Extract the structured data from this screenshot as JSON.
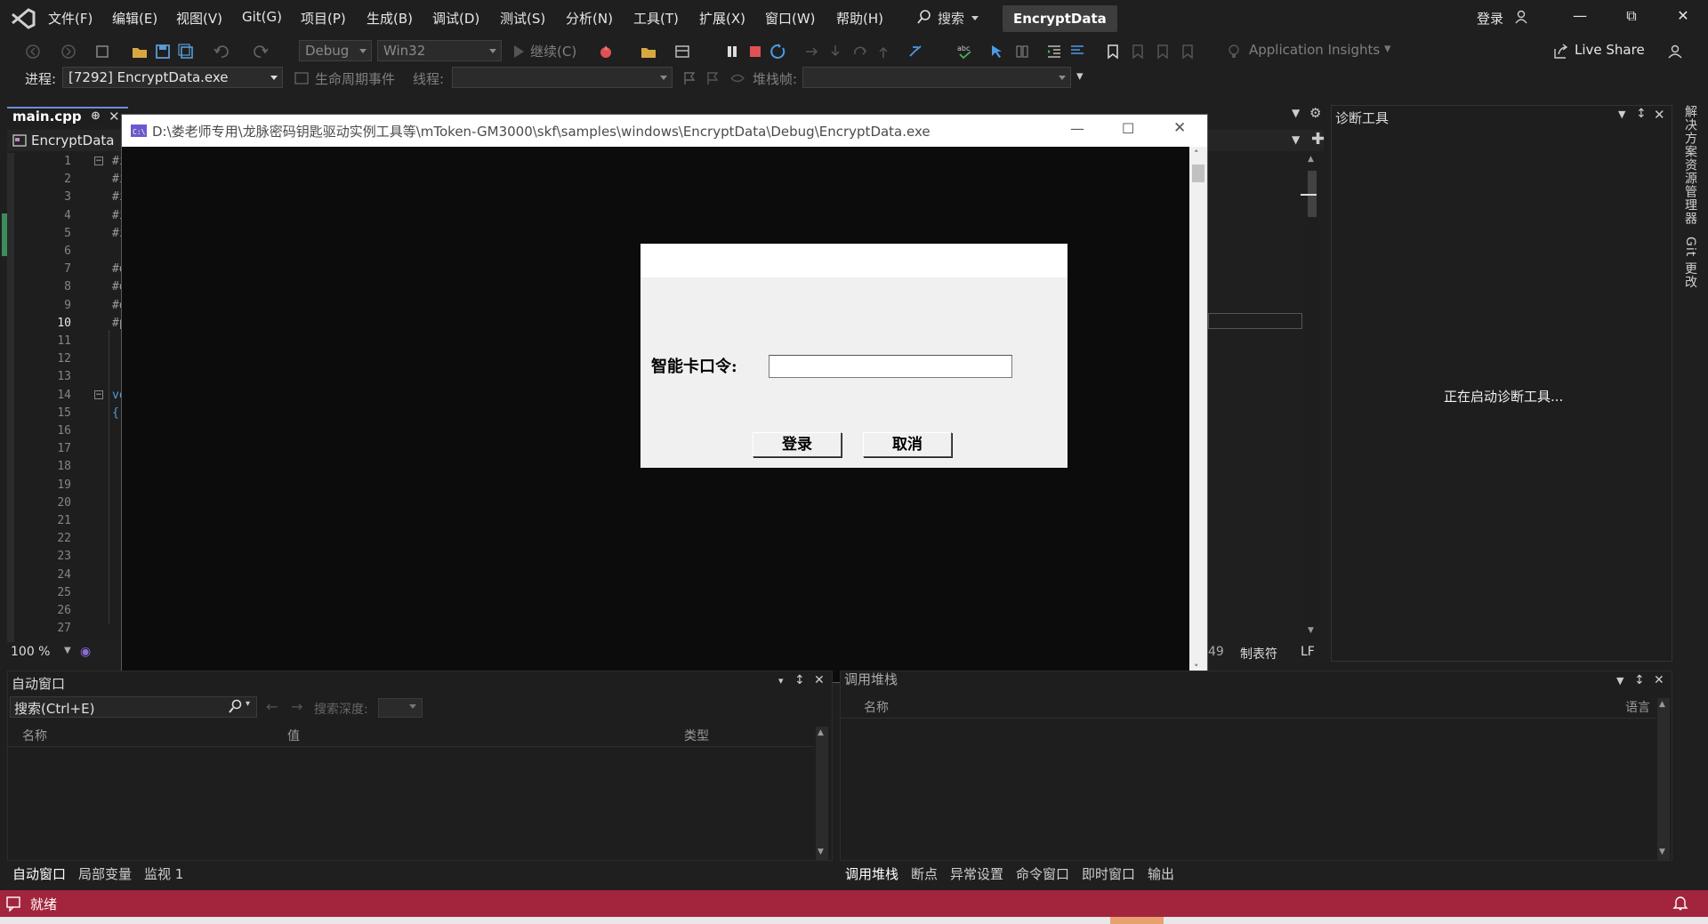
{
  "menu": {
    "items": [
      "文件(F)",
      "编辑(E)",
      "视图(V)",
      "Git(G)",
      "项目(P)",
      "生成(B)",
      "调试(D)",
      "测试(S)",
      "分析(N)",
      "工具(T)",
      "扩展(X)",
      "窗口(W)",
      "帮助(H)"
    ],
    "search_label": "搜索",
    "solution_title": "EncryptData",
    "login_label": "登录"
  },
  "toolbar": {
    "config": "Debug",
    "platform": "Win32",
    "continue_label": "继续(C)",
    "app_insights": "Application Insights",
    "live_share": "Live Share",
    "process_label": "进程:",
    "process_value": "[7292] EncryptData.exe",
    "lifecycle_label": "生命周期事件",
    "thread_label": "线程:",
    "stackframe_label": "堆栈帧:"
  },
  "editor": {
    "tab_name": "main.cpp",
    "project_name": "EncryptData",
    "current_line": 10,
    "line_numbers": [
      "1",
      "2",
      "3",
      "4",
      "5",
      "6",
      "7",
      "8",
      "9",
      "10",
      "11",
      "12",
      "13",
      "14",
      "15",
      "16",
      "17",
      "18",
      "19",
      "20",
      "21",
      "22",
      "23",
      "24",
      "25",
      "26",
      "27"
    ],
    "code_lines": [
      "#i",
      "#i",
      "#i",
      "#i",
      "#i",
      "",
      "#d",
      "#d",
      "#d",
      "#p",
      "",
      "",
      "",
      "vo",
      "{"
    ],
    "zoom": "100 %",
    "status_col": "49",
    "status_indent": "制表符",
    "status_eol": "LF"
  },
  "console": {
    "title": "D:\\娄老师专用\\龙脉密码钥匙驱动实例工具等\\mToken-GM3000\\skf\\samples\\windows\\EncryptData\\Debug\\EncryptData.exe"
  },
  "dialog": {
    "pin_label": "智能卡口令:",
    "pin_value": "",
    "login_button": "登录",
    "cancel_button": "取消"
  },
  "diagnostics": {
    "title": "诊断工具",
    "message": "正在启动诊断工具..."
  },
  "side_tabs": [
    "解决方案资源管理器",
    "Git 更改"
  ],
  "autos": {
    "title": "自动窗口",
    "search_placeholder": "搜索(Ctrl+E)",
    "search_depth_label": "搜索深度:",
    "columns": [
      "名称",
      "值",
      "类型"
    ],
    "tabs": [
      "自动窗口",
      "局部变量",
      "监视 1"
    ]
  },
  "callstack": {
    "title": "调用堆栈",
    "columns": [
      "名称",
      "语言"
    ],
    "tabs": [
      "调用堆栈",
      "断点",
      "异常设置",
      "命令窗口",
      "即时窗口",
      "输出"
    ]
  },
  "statusbar": {
    "text": "就绪"
  },
  "colors": {
    "status_bar": "#a3243d",
    "accent_blue": "#6b8fd6",
    "stop_red": "#e05252"
  }
}
